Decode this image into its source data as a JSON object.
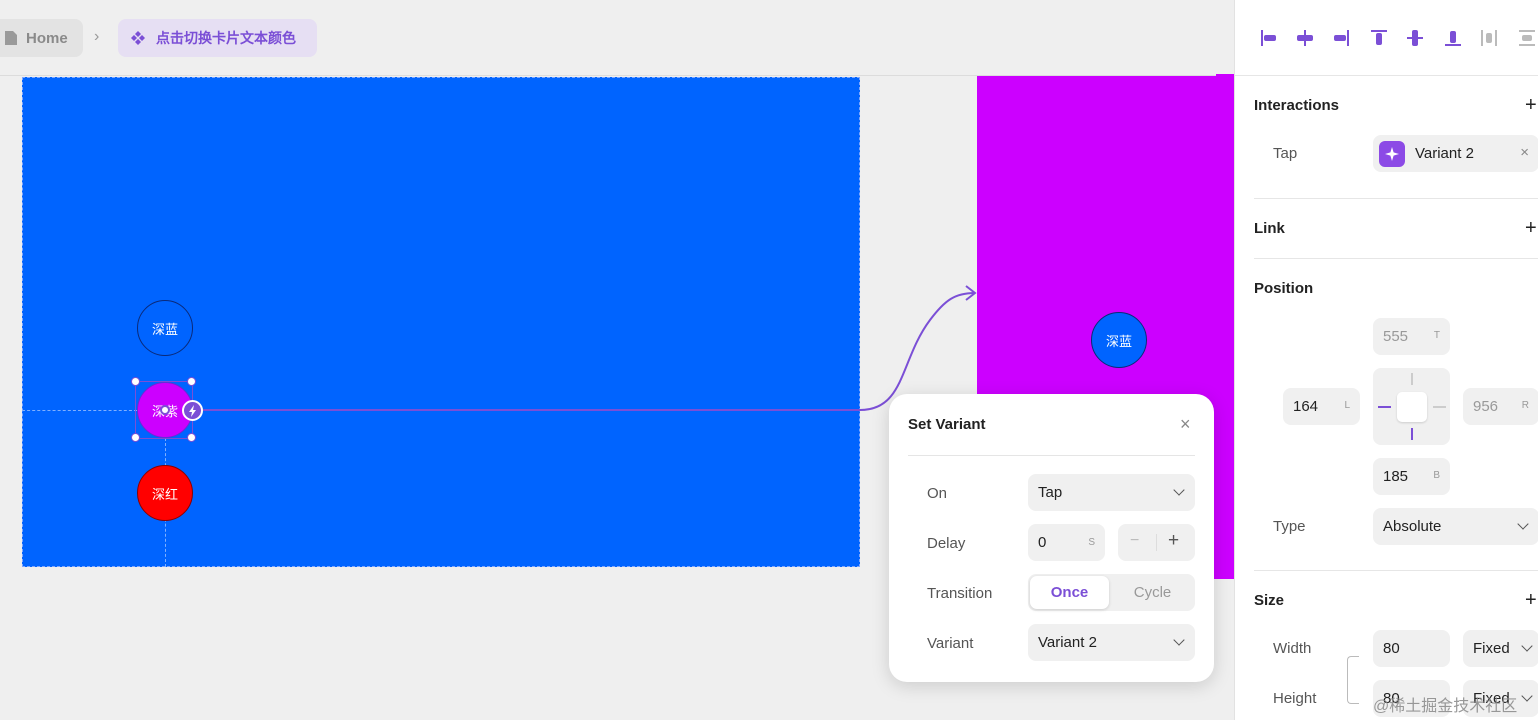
{
  "breadcrumb": {
    "home_label": "Home",
    "component_label": "点击切换卡片文本颜色"
  },
  "canvas": {
    "colors": {
      "blue": "#0064ff",
      "purple": "#cc00ff",
      "red": "#ff0000",
      "accent": "#7b4fd6"
    },
    "left_frame_items": [
      "深蓝",
      "深紫",
      "深红"
    ],
    "right_frame_item": "深蓝"
  },
  "set_variant_popup": {
    "title": "Set Variant",
    "on_label": "On",
    "on_value": "Tap",
    "delay_label": "Delay",
    "delay_value": "0",
    "delay_unit": "S",
    "transition_label": "Transition",
    "transition_options": [
      "Once",
      "Cycle"
    ],
    "transition_selected": "Once",
    "variant_label": "Variant",
    "variant_value": "Variant 2"
  },
  "panel": {
    "interactions": {
      "title": "Interactions",
      "trigger_label": "Tap",
      "target": "Variant 2"
    },
    "link": {
      "title": "Link"
    },
    "position": {
      "title": "Position",
      "top": "555",
      "top_suffix": "T",
      "left": "164",
      "left_suffix": "L",
      "right": "956",
      "right_suffix": "R",
      "bottom": "185",
      "bottom_suffix": "B",
      "type_label": "Type",
      "type_value": "Absolute"
    },
    "size": {
      "title": "Size",
      "width_label": "Width",
      "width_value": "80",
      "width_mode": "Fixed",
      "height_label": "Height",
      "height_value": "80",
      "height_mode": "Fixed"
    }
  },
  "watermark": "@稀土掘金技术社区"
}
